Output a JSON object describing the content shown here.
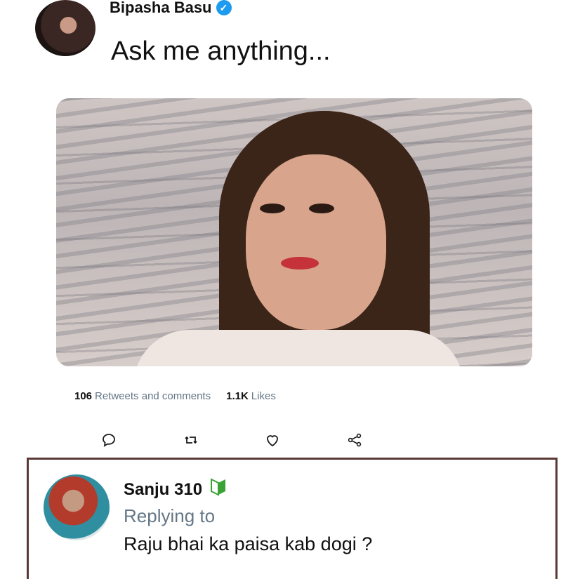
{
  "post": {
    "author": "Bipasha Basu",
    "text": "Ask me anything...",
    "stats": {
      "retweets_count": "106",
      "retweets_label": "Retweets and comments",
      "likes_count": "1.1K",
      "likes_label": "Likes"
    },
    "actions": [
      "comment-icon",
      "retweet-icon",
      "like-icon",
      "share-icon"
    ]
  },
  "reply": {
    "author": "Sanju 310",
    "replying_label": "Replying to",
    "text": "Raju bhai ka paisa kab dogi ?"
  },
  "colors": {
    "verified": "#1d9bf0",
    "badge_green": "#3aa335",
    "muted": "#657786"
  }
}
